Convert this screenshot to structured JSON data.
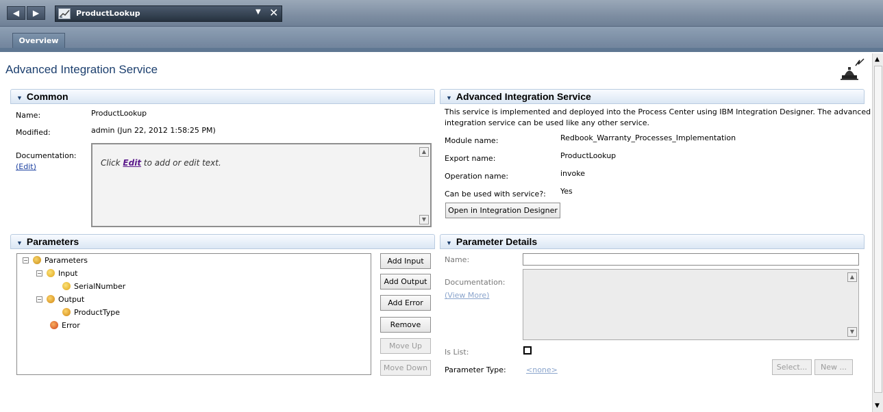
{
  "titlebar": {
    "back_glyph": "◀",
    "forward_glyph": "▶",
    "editor_tab_title": "ProductLookup",
    "dropdown_glyph": "▼",
    "close_glyph": "✕"
  },
  "tabs": [
    {
      "label": "Overview",
      "active": true
    }
  ],
  "page_title": "Advanced Integration Service",
  "common": {
    "heading": "Common",
    "name_label": "Name:",
    "name_value": "ProductLookup",
    "modified_label": "Modified:",
    "modified_value": "admin (Jun 22, 2012 1:58:25 PM)",
    "documentation_label": "Documentation:",
    "documentation_edit_link": "(Edit)",
    "doc_hint_prefix": "Click ",
    "doc_hint_link": "Edit",
    "doc_hint_suffix": " to add or edit text."
  },
  "ais": {
    "heading": "Advanced Integration Service",
    "description_line1": "This service is implemented and deployed into the Process Center using IBM Integration Designer. The advanced",
    "description_line2": "integration service can be used like any other service.",
    "module_label": "Module name:",
    "module_value": "Redbook_Warranty_Processes_Implementation",
    "export_label": "Export name:",
    "export_value": "ProductLookup",
    "operation_label": "Operation name:",
    "operation_value": "invoke",
    "canuse_label": "Can be used with service?:",
    "canuse_value": "Yes",
    "open_button": "Open in Integration Designer"
  },
  "parameters": {
    "heading": "Parameters",
    "tree": {
      "root": "Parameters",
      "input": "Input",
      "input_child": "SerialNumber",
      "output": "Output",
      "output_child": "ProductType",
      "error": "Error"
    },
    "buttons": {
      "add_input": "Add Input",
      "add_output": "Add Output",
      "add_error": "Add Error",
      "remove": "Remove",
      "move_up": "Move Up",
      "move_down": "Move Down"
    }
  },
  "param_details": {
    "heading": "Parameter Details",
    "name_label": "Name:",
    "name_value": "",
    "documentation_label": "Documentation:",
    "view_more_link": "(View More)",
    "is_list_label": "Is List:",
    "is_list_checked": false,
    "type_label": "Parameter Type:",
    "type_value": "<none>",
    "select_button": "Select...",
    "new_button": "New ..."
  },
  "colors": {
    "title_blue": "#1c3f6e",
    "header_gradient_bottom": "#dbe7f4",
    "link_purple": "#5b1a8c",
    "link_blue": "#1a3fa0"
  },
  "icons": {
    "editor_tab": "process-icon",
    "service": "lamp-service-icon",
    "section_caret": "caret-down-icon",
    "parameters_root": "parameters-icon",
    "input": "input-arrow-icon",
    "output": "output-arrow-icon",
    "error": "error-icon"
  }
}
